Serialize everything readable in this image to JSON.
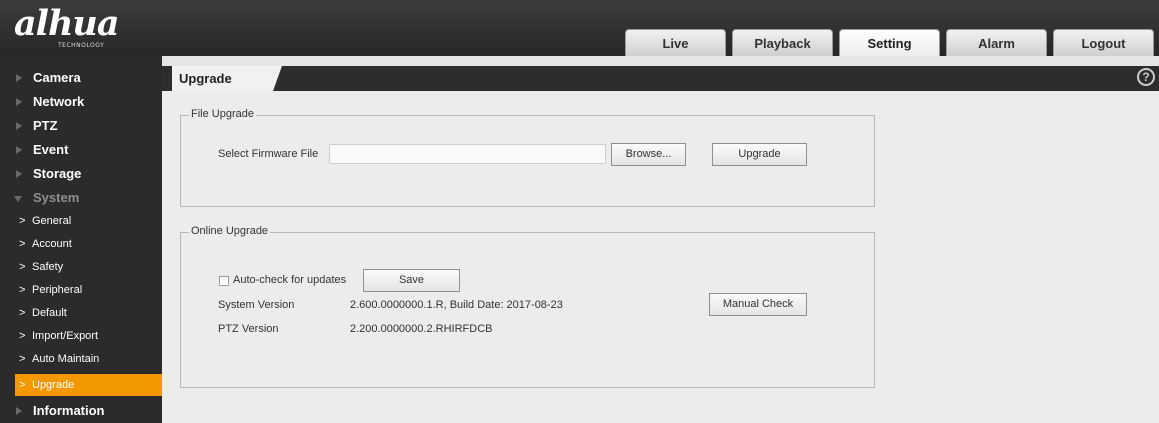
{
  "brand": {
    "logo_text": "alhua",
    "logo_sub": "TECHNOLOGY"
  },
  "top_tabs": [
    {
      "label": "Live"
    },
    {
      "label": "Playback"
    },
    {
      "label": "Setting"
    },
    {
      "label": "Alarm"
    },
    {
      "label": "Logout"
    }
  ],
  "sidebar": {
    "items": [
      {
        "label": "Camera"
      },
      {
        "label": "Network"
      },
      {
        "label": "PTZ"
      },
      {
        "label": "Event"
      },
      {
        "label": "Storage"
      },
      {
        "label": "System"
      }
    ],
    "system_sub": [
      {
        "label": "General"
      },
      {
        "label": "Account"
      },
      {
        "label": "Safety"
      },
      {
        "label": "Peripheral"
      },
      {
        "label": "Default"
      },
      {
        "label": "Import/Export"
      },
      {
        "label": "Auto Maintain"
      },
      {
        "label": "Upgrade"
      }
    ],
    "last_item": {
      "label": "Information"
    }
  },
  "page": {
    "title": "Upgrade",
    "help_glyph": "?"
  },
  "file_upgrade": {
    "legend": "File Upgrade",
    "select_label": "Select Firmware File",
    "file_value": "",
    "browse_label": "Browse...",
    "upgrade_label": "Upgrade"
  },
  "online_upgrade": {
    "legend": "Online Upgrade",
    "auto_check_label": "Auto-check for updates",
    "auto_check_checked": false,
    "save_label": "Save",
    "system_version_label": "System Version",
    "system_version_value": "2.600.0000000.1.R, Build Date: 2017-08-23",
    "manual_check_label": "Manual Check",
    "ptz_version_label": "PTZ Version",
    "ptz_version_value": "2.200.0000000.2.RHIRFDCB"
  },
  "colors": {
    "accent": "#f39800",
    "header": "#2b2b2b",
    "panel": "#ececec"
  }
}
